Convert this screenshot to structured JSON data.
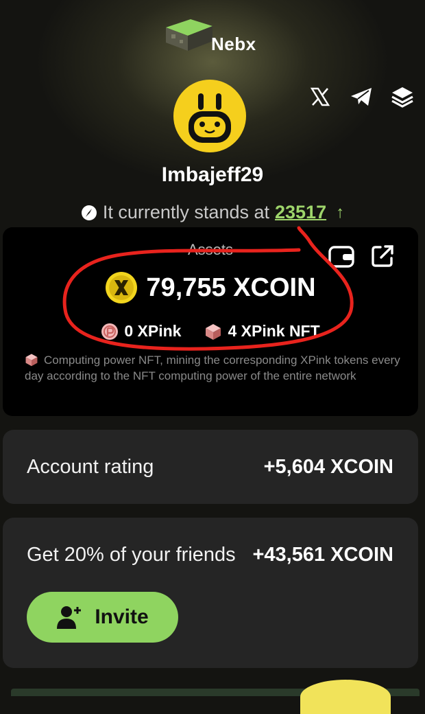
{
  "brand": {
    "name": "Nebx"
  },
  "socials": [
    {
      "icon": "x-icon"
    },
    {
      "icon": "telegram-icon"
    },
    {
      "icon": "layers-icon"
    }
  ],
  "user": {
    "username": "Imbajeff29"
  },
  "stands": {
    "text": "It currently stands at",
    "value": "23517"
  },
  "assets": {
    "title": "Assets",
    "xcoin_amount": "79,755 XCOIN",
    "xpink": "0 XPink",
    "xpink_nft": "4 XPink NFT",
    "note": "Computing power NFT, mining the corresponding XPink tokens every day according to the NFT computing power of the entire network"
  },
  "rating": {
    "label": "Account rating",
    "value": "+5,604 XCOIN"
  },
  "friends": {
    "label": "Get 20% of your friends",
    "value": "+43,561 XCOIN",
    "invite_label": "Invite"
  },
  "colors": {
    "accent": "#8fd460",
    "highlight": "#9ed56b",
    "background": "#141411",
    "card": "#252525",
    "annotation": "#e8231d",
    "coin": "#f2d51e"
  }
}
